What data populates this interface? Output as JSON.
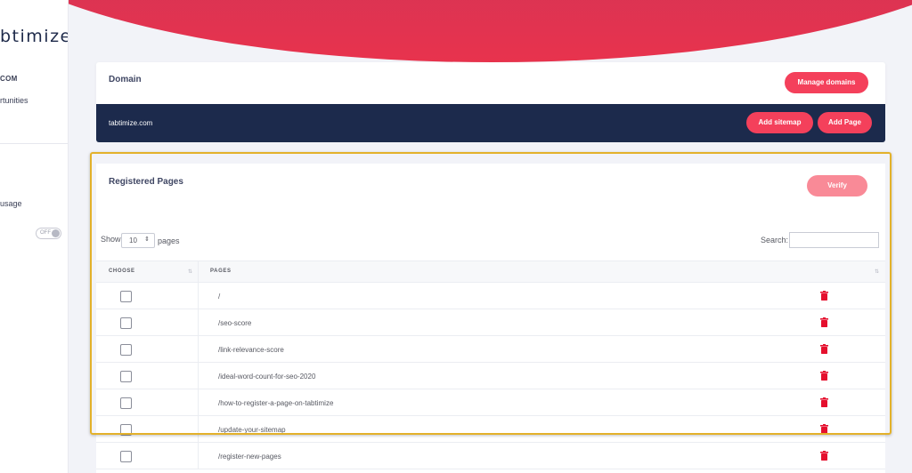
{
  "sidebar": {
    "logo": "btimize",
    "domain_label": "COM",
    "opportunities_label": "rtunities",
    "usage_label": "usage",
    "toggle_label": "OFF"
  },
  "domain_card": {
    "title": "Domain",
    "manage_button": "Manage domains",
    "domain_name": "tabtimize.com",
    "add_sitemap_button": "Add sitemap",
    "add_page_button": "Add Page"
  },
  "pages_card": {
    "title": "Registered Pages",
    "verify_button": "Verify",
    "show_label": "Show",
    "page_size": "10",
    "pages_label": "pages",
    "search_label": "Search:",
    "search_value": "",
    "columns": {
      "choose": "CHOOSE",
      "pages": "PAGES"
    },
    "rows": [
      "/",
      "/seo-score",
      "/link-relevance-score",
      "/ideal-word-count-for-seo-2020",
      "/how-to-register-a-page-on-tabtimize",
      "/update-your-sitemap",
      "/register-new-pages"
    ]
  },
  "colors": {
    "accent": "#f4405b",
    "accent_disabled": "#f98a97",
    "navy": "#1c2a4c",
    "highlight": "#e3b12a",
    "trash": "#e5102e"
  },
  "icons": {
    "sort": "sort-arrows-icon",
    "select": "up-down-chevron-icon",
    "delete": "trash-icon"
  }
}
